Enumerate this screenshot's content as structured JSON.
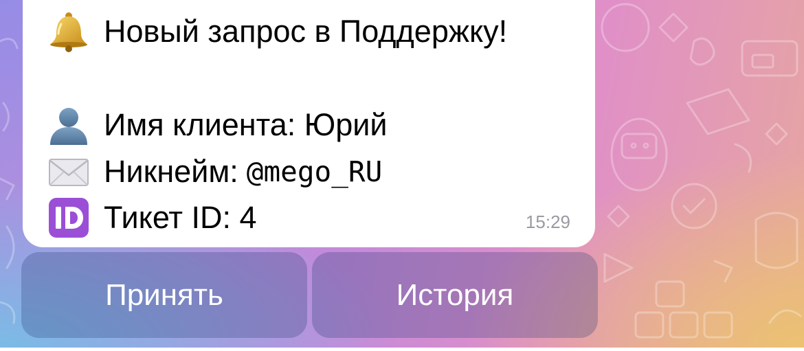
{
  "message": {
    "title": "Новый запрос в Поддержку!",
    "client_name": "Имя клиента: Юрий",
    "nickname_label": "Никнейм:",
    "nickname_value": "@mego_RU",
    "ticket": "Тикет ID: 4",
    "time": "15:29",
    "icons": {
      "title": "bell-icon",
      "client": "bust-in-silhouette-icon",
      "nickname": "envelope-icon",
      "ticket": "id-button-icon"
    }
  },
  "buttons": {
    "accept_label": "Принять",
    "history_label": "История"
  },
  "colors": {
    "bubble": "#ffffff",
    "time": "#9a9aa2",
    "id_badge": "#9b4fd6",
    "button_text": "#ffffff"
  }
}
